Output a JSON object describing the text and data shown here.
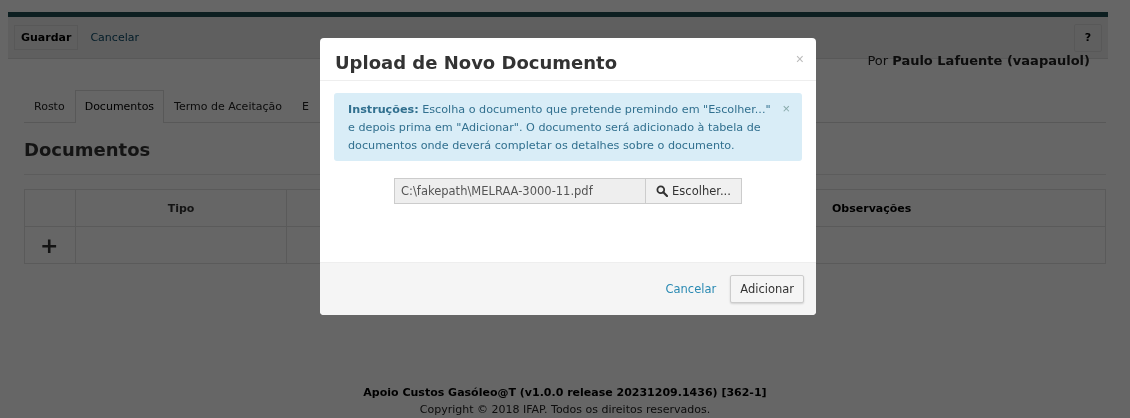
{
  "toolbar": {
    "buttons": [
      {
        "label": "Guardar",
        "kind": "button"
      },
      {
        "label": "Cancelar",
        "kind": "link"
      }
    ],
    "help_icon": "?"
  },
  "author": {
    "prefix": "Por",
    "name": "Paulo Lafuente (vaapaulol)"
  },
  "tabs": [
    {
      "label": "Rosto",
      "selected": false
    },
    {
      "label": "Documentos",
      "selected": true
    },
    {
      "label": "Termo de Aceitação",
      "selected": false
    },
    {
      "label": "E",
      "selected": false
    }
  ],
  "heading": "Documentos",
  "table": {
    "columns": [
      "Tipo",
      "Observações"
    ],
    "add_button": "+"
  },
  "footer": {
    "version": "Apoio Custos Gasóleo@T (v1.0.0 release 20231209.1436) [362-1]",
    "copyright": "Copyright © 2018 IFAP. Todos os direitos reservados."
  },
  "modal": {
    "title": "Upload de Novo Documento",
    "close": "×",
    "alert": {
      "text": "**Instruções:** Escolha o documento que pretende premindo em \"Escolher...\" e depois prima em \"Adicionar\". O documento será adicionado à tabela de documentos onde deverá completar os detalhes sobre o documento.",
      "close": "×"
    },
    "file_field": {
      "value": "C:\\fakepath\\MELRAA-3000-11.pdf",
      "button": "Escolher..."
    },
    "actions": [
      {
        "label": "Cancelar",
        "kind": "link"
      },
      {
        "label": "Adicionar",
        "kind": "button"
      }
    ]
  }
}
